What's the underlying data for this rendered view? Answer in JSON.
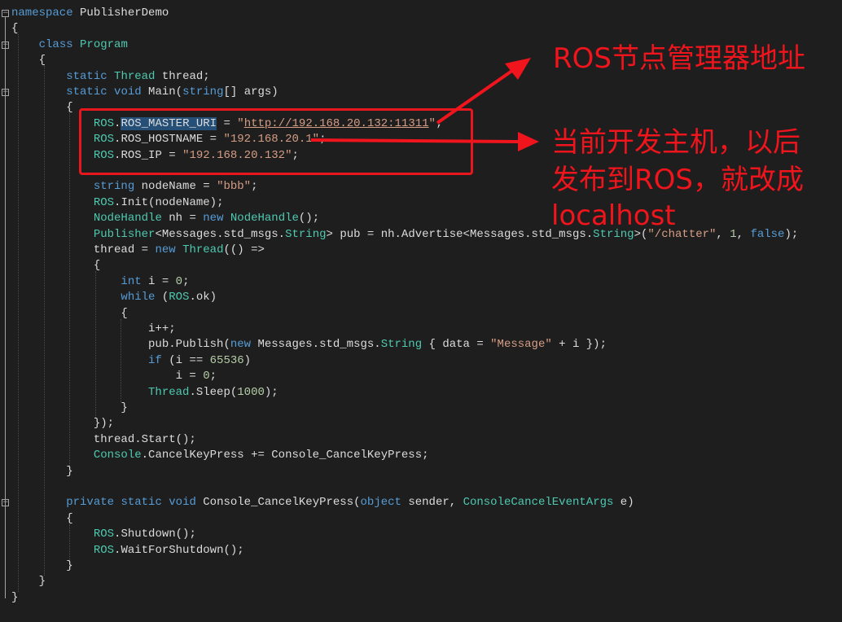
{
  "code_lines": [
    [
      [
        "kw",
        "namespace"
      ],
      [
        "id",
        " PublisherDemo"
      ]
    ],
    [
      [
        "id",
        "{"
      ]
    ],
    [
      [
        "id",
        "    "
      ],
      [
        "kw",
        "class"
      ],
      [
        "id",
        " "
      ],
      [
        "ty",
        "Program"
      ]
    ],
    [
      [
        "id",
        "    {"
      ]
    ],
    [
      [
        "id",
        "        "
      ],
      [
        "kw",
        "static"
      ],
      [
        "id",
        " "
      ],
      [
        "ty",
        "Thread"
      ],
      [
        "id",
        " thread;"
      ]
    ],
    [
      [
        "id",
        "        "
      ],
      [
        "kw",
        "static"
      ],
      [
        "id",
        " "
      ],
      [
        "kw",
        "void"
      ],
      [
        "id",
        " Main("
      ],
      [
        "kw",
        "string"
      ],
      [
        "id",
        "[] args)"
      ]
    ],
    [
      [
        "id",
        "        {"
      ]
    ],
    [
      [
        "id",
        "            "
      ],
      [
        "ty",
        "ROS"
      ],
      [
        "id",
        "."
      ],
      [
        "sel",
        "ROS_MASTER_URI"
      ],
      [
        "id",
        " = "
      ],
      [
        "st",
        "\""
      ],
      [
        "url",
        "http://192.168.20.132:11311"
      ],
      [
        "st",
        "\""
      ],
      [
        "id",
        ";"
      ]
    ],
    [
      [
        "id",
        "            "
      ],
      [
        "ty",
        "ROS"
      ],
      [
        "id",
        ".ROS_HOSTNAME = "
      ],
      [
        "st",
        "\"192.168.20.1\""
      ],
      [
        "id",
        ";"
      ]
    ],
    [
      [
        "id",
        "            "
      ],
      [
        "ty",
        "ROS"
      ],
      [
        "id",
        ".ROS_IP = "
      ],
      [
        "st",
        "\"192.168.20.132\""
      ],
      [
        "id",
        ";"
      ]
    ],
    [
      [
        "id",
        ""
      ]
    ],
    [
      [
        "id",
        "            "
      ],
      [
        "kw",
        "string"
      ],
      [
        "id",
        " nodeName = "
      ],
      [
        "st",
        "\"bbb\""
      ],
      [
        "id",
        ";"
      ]
    ],
    [
      [
        "id",
        "            "
      ],
      [
        "ty",
        "ROS"
      ],
      [
        "id",
        ".Init(nodeName);"
      ]
    ],
    [
      [
        "id",
        "            "
      ],
      [
        "ty",
        "NodeHandle"
      ],
      [
        "id",
        " nh = "
      ],
      [
        "kw",
        "new"
      ],
      [
        "id",
        " "
      ],
      [
        "ty",
        "NodeHandle"
      ],
      [
        "id",
        "();"
      ]
    ],
    [
      [
        "id",
        "            "
      ],
      [
        "ty",
        "Publisher"
      ],
      [
        "id",
        "<Messages.std_msgs."
      ],
      [
        "ty",
        "String"
      ],
      [
        "id",
        "> pub = nh.Advertise<Messages.std_msgs."
      ],
      [
        "ty",
        "String"
      ],
      [
        "id",
        ">("
      ],
      [
        "st",
        "\"/chatter\""
      ],
      [
        "id",
        ", "
      ],
      [
        "nm",
        "1"
      ],
      [
        "id",
        ", "
      ],
      [
        "kw",
        "false"
      ],
      [
        "id",
        ");"
      ]
    ],
    [
      [
        "id",
        "            thread = "
      ],
      [
        "kw",
        "new"
      ],
      [
        "id",
        " "
      ],
      [
        "ty",
        "Thread"
      ],
      [
        "id",
        "(() =>"
      ]
    ],
    [
      [
        "id",
        "            {"
      ]
    ],
    [
      [
        "id",
        "                "
      ],
      [
        "kw",
        "int"
      ],
      [
        "id",
        " i = "
      ],
      [
        "nm",
        "0"
      ],
      [
        "id",
        ";"
      ]
    ],
    [
      [
        "id",
        "                "
      ],
      [
        "kw",
        "while"
      ],
      [
        "id",
        " ("
      ],
      [
        "ty",
        "ROS"
      ],
      [
        "id",
        ".ok)"
      ]
    ],
    [
      [
        "id",
        "                {"
      ]
    ],
    [
      [
        "id",
        "                    i++;"
      ]
    ],
    [
      [
        "id",
        "                    pub.Publish("
      ],
      [
        "kw",
        "new"
      ],
      [
        "id",
        " Messages.std_msgs."
      ],
      [
        "ty",
        "String"
      ],
      [
        "id",
        " { data = "
      ],
      [
        "st",
        "\"Message\""
      ],
      [
        "id",
        " + i });"
      ]
    ],
    [
      [
        "id",
        "                    "
      ],
      [
        "kw",
        "if"
      ],
      [
        "id",
        " (i == "
      ],
      [
        "nm",
        "65536"
      ],
      [
        "id",
        ")"
      ]
    ],
    [
      [
        "id",
        "                        i = "
      ],
      [
        "nm",
        "0"
      ],
      [
        "id",
        ";"
      ]
    ],
    [
      [
        "id",
        "                    "
      ],
      [
        "ty",
        "Thread"
      ],
      [
        "id",
        ".Sleep("
      ],
      [
        "nm",
        "1000"
      ],
      [
        "id",
        ");"
      ]
    ],
    [
      [
        "id",
        "                }"
      ]
    ],
    [
      [
        "id",
        "            });"
      ]
    ],
    [
      [
        "id",
        "            thread.Start();"
      ]
    ],
    [
      [
        "id",
        "            "
      ],
      [
        "ty",
        "Console"
      ],
      [
        "id",
        ".CancelKeyPress += Console_CancelKeyPress;"
      ]
    ],
    [
      [
        "id",
        "        }"
      ]
    ],
    [
      [
        "id",
        ""
      ]
    ],
    [
      [
        "id",
        "        "
      ],
      [
        "kw",
        "private"
      ],
      [
        "id",
        " "
      ],
      [
        "kw",
        "static"
      ],
      [
        "id",
        " "
      ],
      [
        "kw",
        "void"
      ],
      [
        "id",
        " Console_CancelKeyPress("
      ],
      [
        "kw",
        "object"
      ],
      [
        "id",
        " sender, "
      ],
      [
        "ty",
        "ConsoleCancelEventArgs"
      ],
      [
        "id",
        " e)"
      ]
    ],
    [
      [
        "id",
        "        {"
      ]
    ],
    [
      [
        "id",
        "            "
      ],
      [
        "ty",
        "ROS"
      ],
      [
        "id",
        ".Shutdown();"
      ]
    ],
    [
      [
        "id",
        "            "
      ],
      [
        "ty",
        "ROS"
      ],
      [
        "id",
        ".WaitForShutdown();"
      ]
    ],
    [
      [
        "id",
        "        }"
      ]
    ],
    [
      [
        "id",
        "    }"
      ]
    ],
    [
      [
        "id",
        "}"
      ]
    ]
  ],
  "fold_markers": [
    "−",
    "−",
    "−",
    "−"
  ],
  "annotations": {
    "master_note": "ROS节点管理器地址",
    "host_note_line1": "当前开发主机，以后",
    "host_note_line2": "发布到ROS，就改成",
    "host_note_line3": "localhost"
  },
  "colors": {
    "background": "#1e1e1e",
    "keyword": "#569cd6",
    "type": "#4ec9b0",
    "string": "#d69d85",
    "number": "#b5cea8",
    "text": "#dcdcdc",
    "selection": "#264f78",
    "annotation": "#f0141c"
  }
}
